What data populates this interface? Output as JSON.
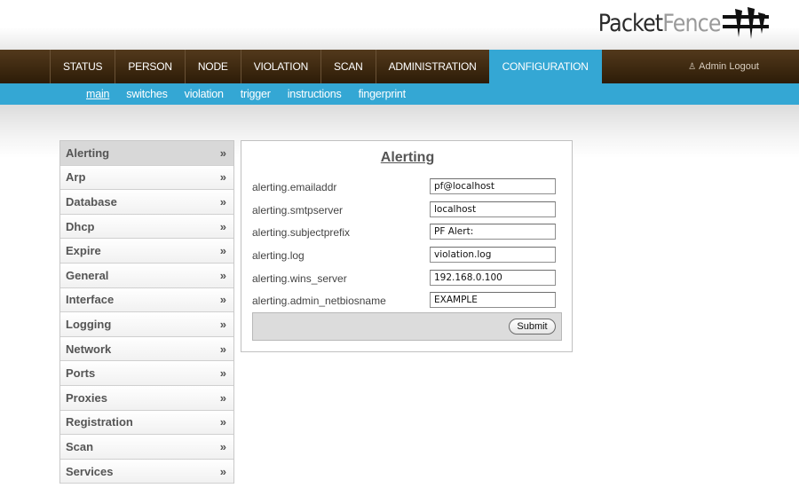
{
  "logo": {
    "text_dark": "Packet",
    "text_light": "Fence"
  },
  "nav": {
    "tabs": [
      {
        "label": "STATUS"
      },
      {
        "label": "PERSON"
      },
      {
        "label": "NODE"
      },
      {
        "label": "VIOLATION"
      },
      {
        "label": "SCAN"
      },
      {
        "label": "ADMINISTRATION"
      },
      {
        "label": "CONFIGURATION"
      }
    ],
    "active_tab": "CONFIGURATION",
    "admin_logout": "Admin Logout"
  },
  "subnav": {
    "items": [
      {
        "label": "main"
      },
      {
        "label": "switches"
      },
      {
        "label": "violation"
      },
      {
        "label": "trigger"
      },
      {
        "label": "instructions"
      },
      {
        "label": "fingerprint"
      }
    ],
    "active_item": "main"
  },
  "sidebar": {
    "arrow": "»",
    "items": [
      {
        "label": "Alerting"
      },
      {
        "label": "Arp"
      },
      {
        "label": "Database"
      },
      {
        "label": "Dhcp"
      },
      {
        "label": "Expire"
      },
      {
        "label": "General"
      },
      {
        "label": "Interface"
      },
      {
        "label": "Logging"
      },
      {
        "label": "Network"
      },
      {
        "label": "Ports"
      },
      {
        "label": "Proxies"
      },
      {
        "label": "Registration"
      },
      {
        "label": "Scan"
      },
      {
        "label": "Services"
      }
    ],
    "active_item": "Alerting"
  },
  "panel": {
    "title": "Alerting",
    "fields": [
      {
        "label": "alerting.emailaddr",
        "value": "pf@localhost"
      },
      {
        "label": "alerting.smtpserver",
        "value": "localhost"
      },
      {
        "label": "alerting.subjectprefix",
        "value": "PF Alert:"
      },
      {
        "label": "alerting.log",
        "value": "violation.log"
      },
      {
        "label": "alerting.wins_server",
        "value": "192.168.0.100"
      },
      {
        "label": "alerting.admin_netbiosname",
        "value": "EXAMPLE"
      }
    ],
    "submit_label": "Submit"
  },
  "colors": {
    "nav_brown": "#3e2910",
    "accent_blue": "#34a7d4"
  }
}
